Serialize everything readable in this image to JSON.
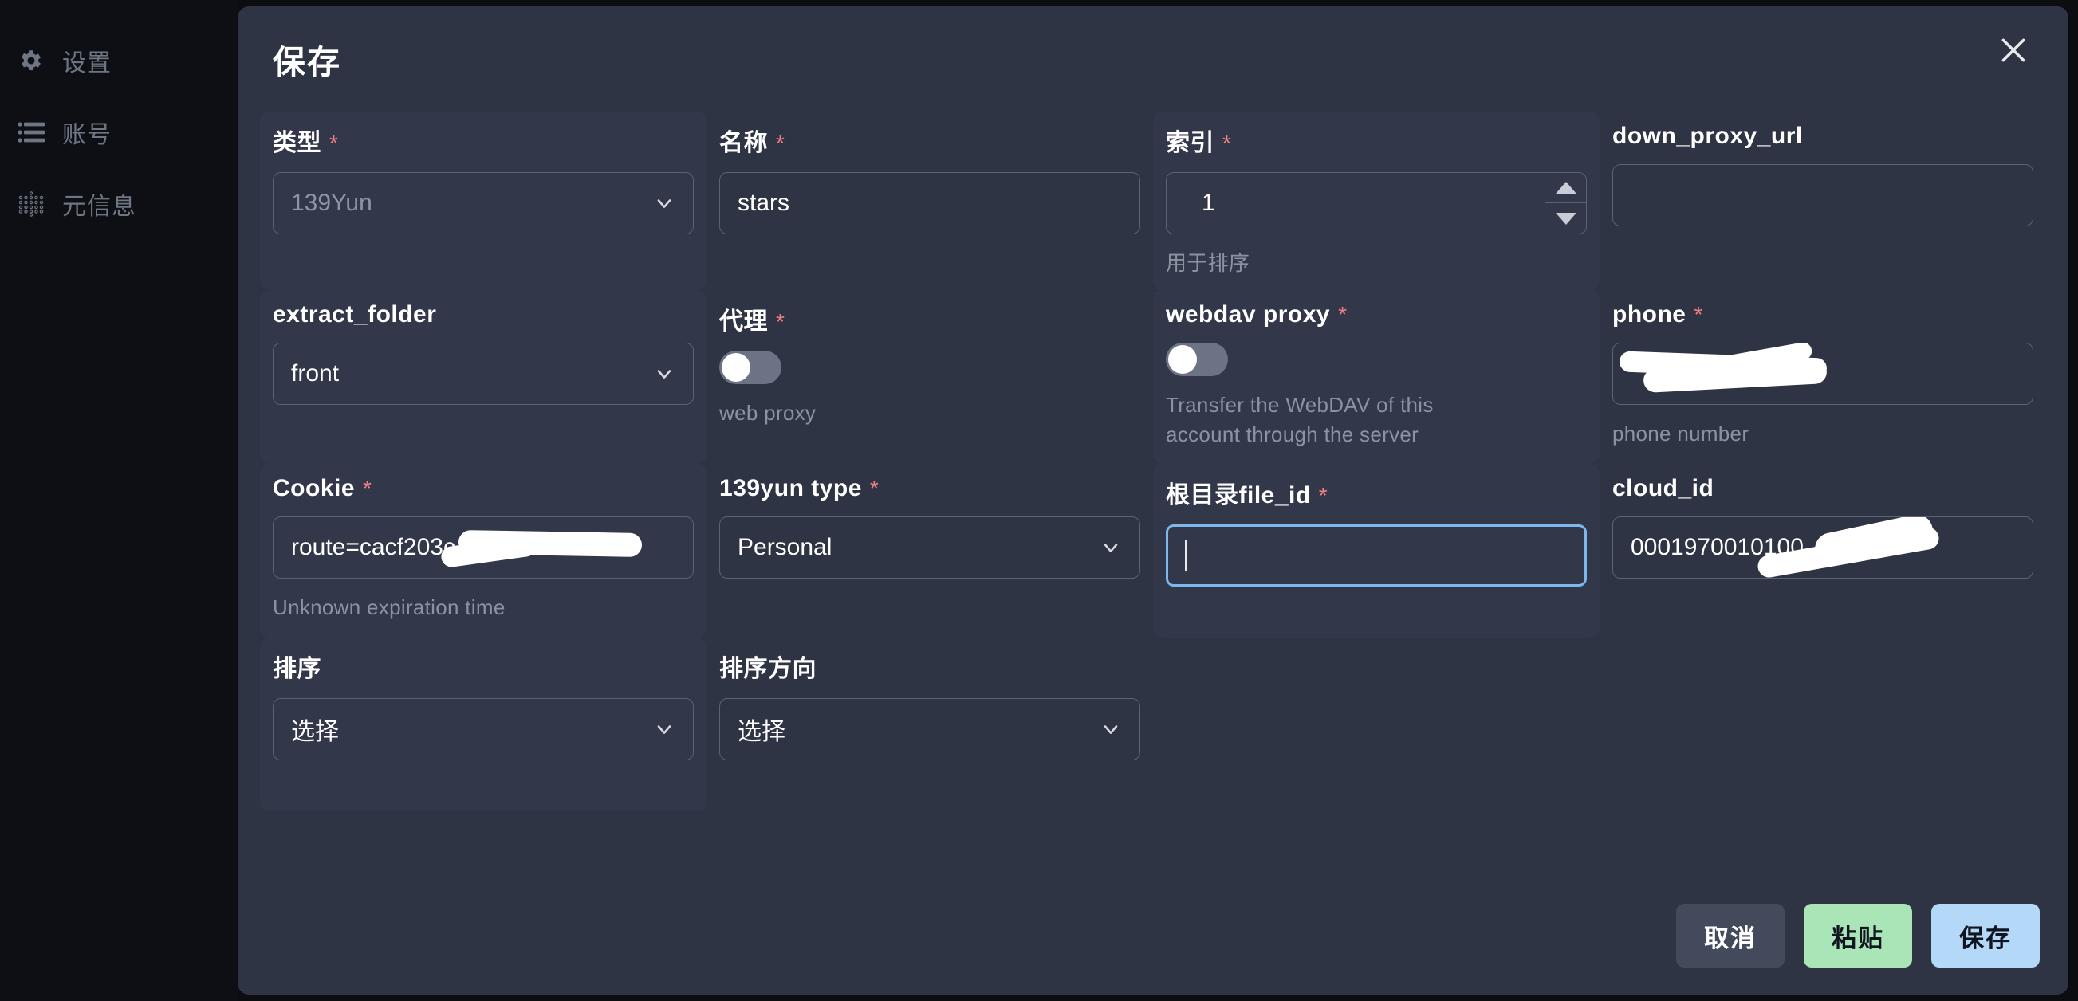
{
  "sidebar": {
    "items": [
      {
        "label": "设置",
        "icon": "gear-icon"
      },
      {
        "label": "账号",
        "icon": "list-icon"
      },
      {
        "label": "元信息",
        "icon": "dots-grid-icon"
      }
    ]
  },
  "modal": {
    "title": "保存",
    "close_icon": "close-icon"
  },
  "fields": {
    "type": {
      "label": "类型",
      "required": "*",
      "value": "139Yun",
      "help": ""
    },
    "name": {
      "label": "名称",
      "required": "*",
      "value": "stars",
      "help": ""
    },
    "index": {
      "label": "索引",
      "required": "*",
      "value": "1",
      "help": "用于排序"
    },
    "down_proxy_url": {
      "label": "down_proxy_url",
      "required": "",
      "value": "",
      "help": ""
    },
    "extract_folder": {
      "label": "extract_folder",
      "required": "",
      "value": "front",
      "help": ""
    },
    "proxy": {
      "label": "代理",
      "required": "*",
      "value": "off",
      "help": "web proxy"
    },
    "webdav_proxy": {
      "label": "webdav proxy",
      "required": "*",
      "value": "off",
      "help": "Transfer the WebDAV of this account through the server"
    },
    "phone": {
      "label": "phone",
      "required": "*",
      "value": "",
      "help": "phone number"
    },
    "cookie": {
      "label": "Cookie",
      "required": "*",
      "value": "route=cacf203c",
      "help": "Unknown expiration time"
    },
    "yun_type": {
      "label": "139yun type",
      "required": "*",
      "value": "Personal",
      "help": ""
    },
    "root_file_id": {
      "label": "根目录file_id",
      "required": "*",
      "value": "",
      "help": ""
    },
    "cloud_id": {
      "label": "cloud_id",
      "required": "",
      "value": "0001970010100",
      "help": ""
    },
    "order_by": {
      "label": "排序",
      "required": "",
      "value": "选择",
      "help": ""
    },
    "order_direction": {
      "label": "排序方向",
      "required": "",
      "value": "选择",
      "help": ""
    }
  },
  "footer": {
    "cancel_label": "取消",
    "paste_label": "粘贴",
    "save_label": "保存"
  },
  "colors": {
    "modal_bg": "#2f3444",
    "page_bg": "#0c0d11",
    "sidebar_bg": "#0e0f14",
    "accent_focus": "#7cb8ee",
    "required_star": "#f08080",
    "paste_btn": "#a9e5b6",
    "save_btn": "#b4d8f7",
    "cancel_btn": "#434a5c"
  }
}
